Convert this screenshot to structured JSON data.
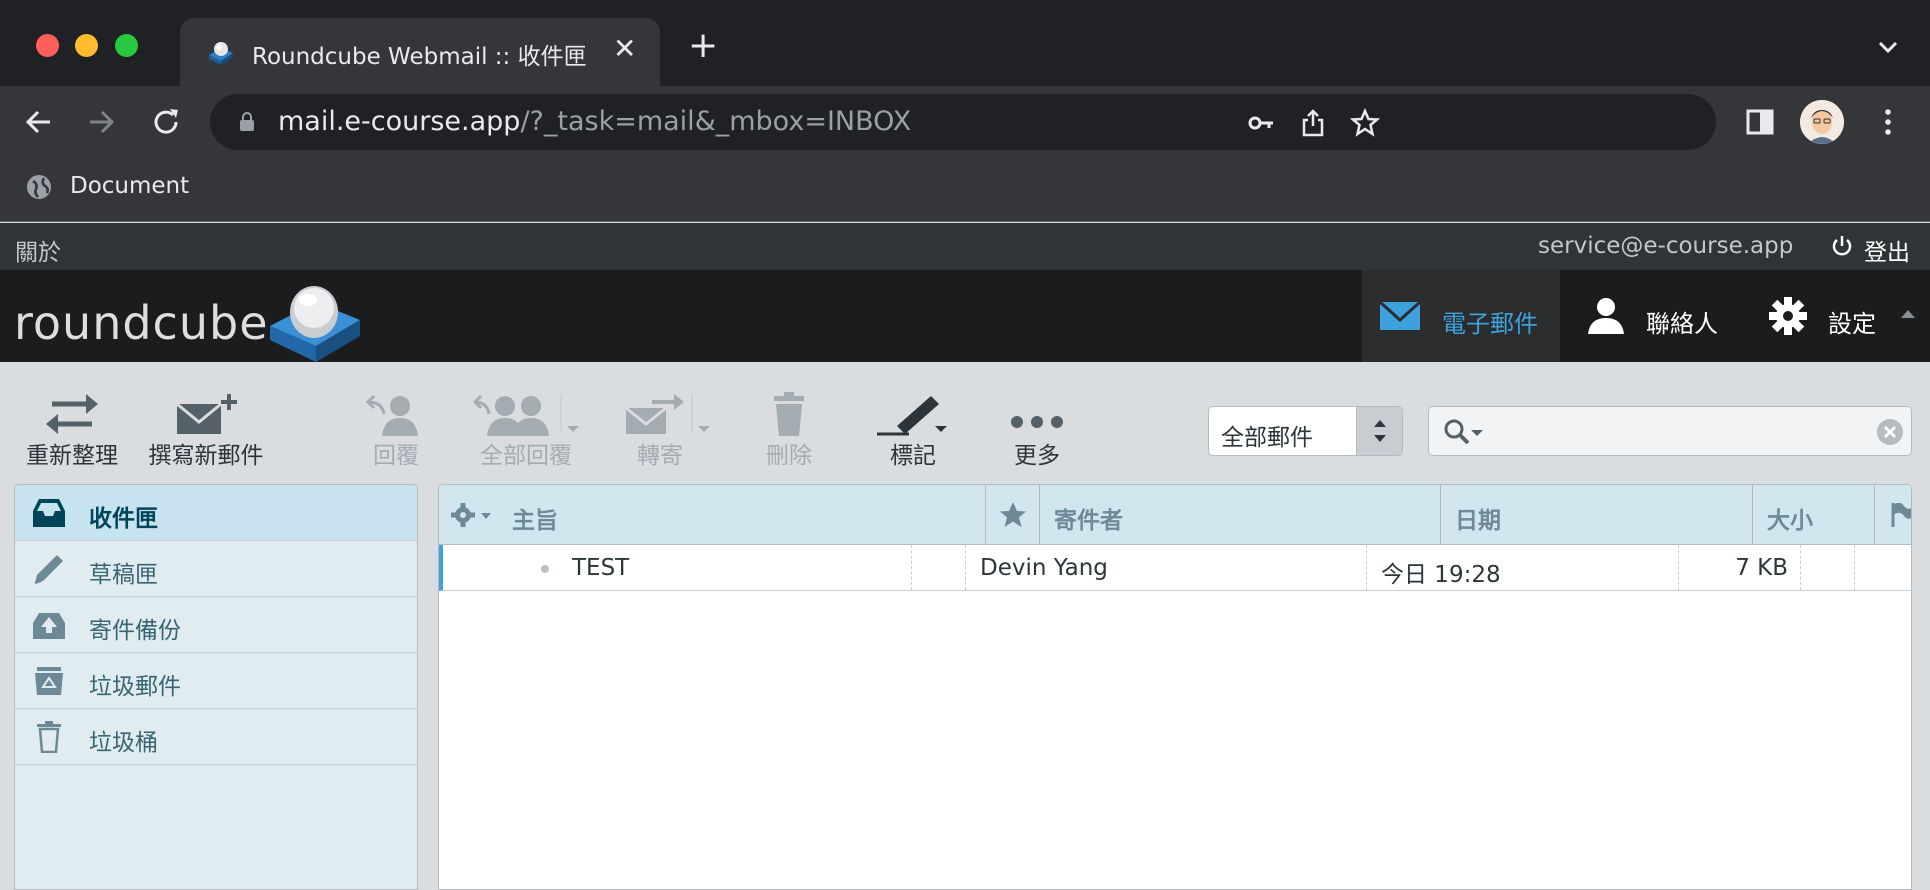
{
  "browser": {
    "tab_title": "Roundcube Webmail :: 收件匣",
    "tab_close": "✕",
    "new_tab": "+",
    "url_host": "mail.e-course.app",
    "url_path": "/?_task=mail&_mbox=INBOX",
    "bookmark_label": "Document"
  },
  "topline": {
    "about": "關於",
    "username": "service@e-course.app",
    "logout": "登出"
  },
  "header": {
    "logo": "roundcube",
    "tasks": [
      {
        "label": "電子郵件",
        "icon": "mail-icon"
      },
      {
        "label": "聯絡人",
        "icon": "contacts-icon"
      },
      {
        "label": "設定",
        "icon": "gear-icon"
      }
    ]
  },
  "toolbar": {
    "refresh": "重新整理",
    "compose": "撰寫新郵件",
    "reply": "回覆",
    "reply_all": "全部回覆",
    "forward": "轉寄",
    "delete": "刪除",
    "mark": "標記",
    "more": "更多",
    "filter_value": "全部郵件",
    "search_placeholder": ""
  },
  "folders": [
    {
      "label": "收件匣",
      "icon": "inbox-icon",
      "selected": true
    },
    {
      "label": "草稿匣",
      "icon": "pencil-icon"
    },
    {
      "label": "寄件備份",
      "icon": "sent-icon"
    },
    {
      "label": "垃圾郵件",
      "icon": "junk-icon"
    },
    {
      "label": "垃圾桶",
      "icon": "trash-icon"
    }
  ],
  "messagelist": {
    "columns": {
      "subject": "主旨",
      "from": "寄件者",
      "date": "日期",
      "size": "大小"
    },
    "rows": [
      {
        "subject": "TEST",
        "from": "Devin Yang",
        "date": "今日 19:28",
        "size": "7 KB"
      }
    ]
  },
  "colors": {
    "accent": "#3da2dc",
    "header_bg": "#1b1c1d",
    "folder_bg": "#e1ecf1",
    "list_header_bg": "#d2e6ef"
  }
}
